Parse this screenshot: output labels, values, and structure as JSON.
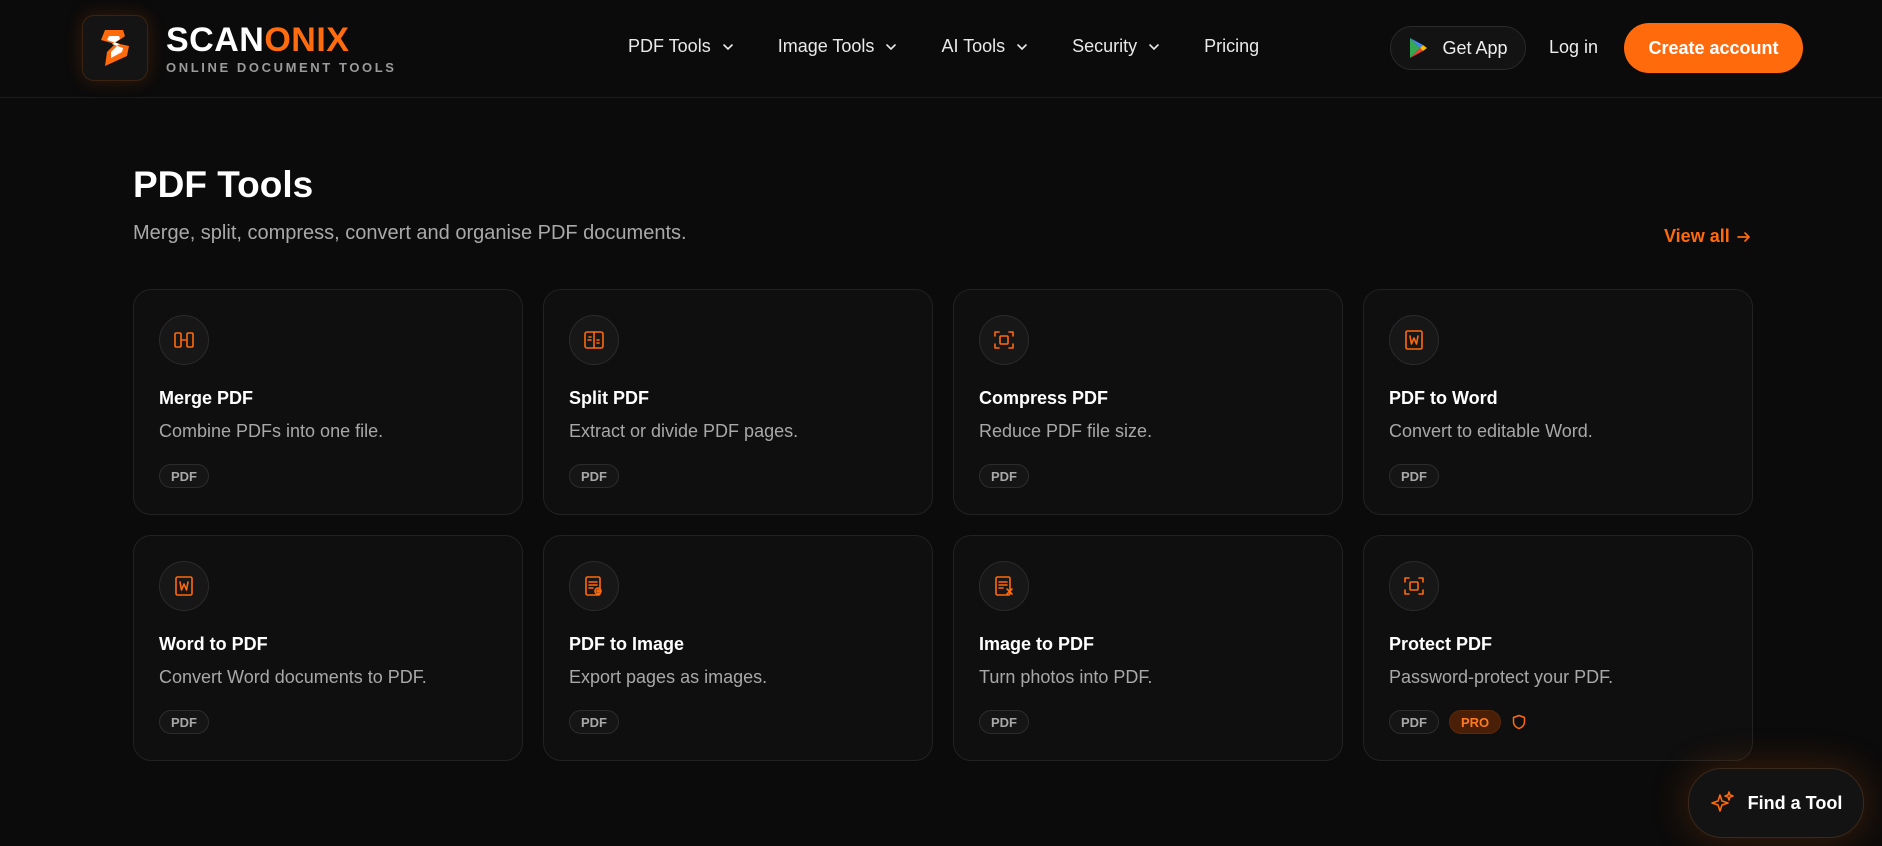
{
  "brand": {
    "name_part1": "SCAN",
    "name_part2": "ONIX",
    "tagline": "ONLINE DOCUMENT TOOLS",
    "accent_color": "#ff6a0c",
    "logo_icon": "lightning-s-icon"
  },
  "nav": {
    "items": [
      {
        "label": "PDF Tools",
        "has_dropdown": true
      },
      {
        "label": "Image Tools",
        "has_dropdown": true
      },
      {
        "label": "AI Tools",
        "has_dropdown": true
      },
      {
        "label": "Security",
        "has_dropdown": true
      },
      {
        "label": "Pricing",
        "has_dropdown": false
      }
    ],
    "get_app_label": "Get App",
    "get_app_icon": "google-play-icon",
    "login_label": "Log in",
    "create_account_label": "Create account"
  },
  "section": {
    "title": "PDF Tools",
    "subtitle": "Merge, split, compress, convert and organise PDF documents.",
    "view_all_label": "View all"
  },
  "cards": [
    {
      "title": "Merge PDF",
      "desc": "Combine PDFs into one file.",
      "icon": "merge-icon",
      "tags": [
        "PDF"
      ]
    },
    {
      "title": "Split PDF",
      "desc": "Extract or divide PDF pages.",
      "icon": "split-icon",
      "tags": [
        "PDF"
      ]
    },
    {
      "title": "Compress PDF",
      "desc": "Reduce PDF file size.",
      "icon": "compress-icon",
      "tags": [
        "PDF"
      ]
    },
    {
      "title": "PDF to Word",
      "desc": "Convert to editable Word.",
      "icon": "word-doc-icon",
      "tags": [
        "PDF"
      ]
    },
    {
      "title": "Word to PDF",
      "desc": "Convert Word documents to PDF.",
      "icon": "word-doc-icon",
      "tags": [
        "PDF"
      ]
    },
    {
      "title": "PDF to Image",
      "desc": "Export pages as images.",
      "icon": "pdf-image-icon",
      "tags": [
        "PDF"
      ]
    },
    {
      "title": "Image to PDF",
      "desc": "Turn photos into PDF.",
      "icon": "image-pdf-icon",
      "tags": [
        "PDF"
      ]
    },
    {
      "title": "Protect PDF",
      "desc": "Password-protect your PDF.",
      "icon": "protect-icon",
      "tags": [
        "PDF",
        "PRO"
      ],
      "shield_icon": "shield-icon"
    }
  ],
  "floating": {
    "find_tool_label": "Find a Tool",
    "find_tool_icon": "sparkle-icon"
  }
}
